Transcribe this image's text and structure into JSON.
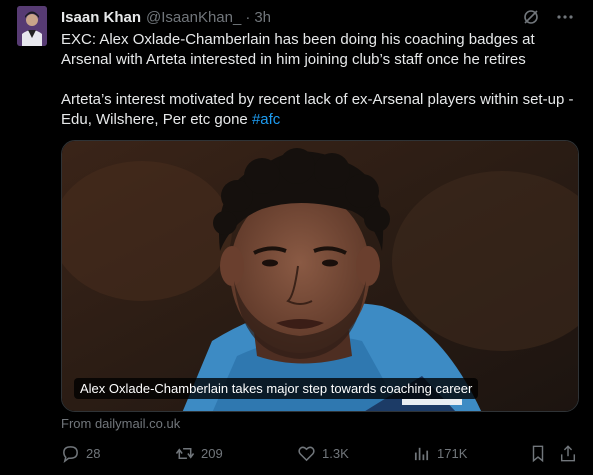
{
  "tweet": {
    "author_name": "Isaan Khan",
    "handle": "@IsaanKhan_",
    "separator": "·",
    "time": "3h",
    "paragraph_1": "EXC: Alex Oxlade-Chamberlain has been doing his coaching badges at Arsenal with Arteta interested in him joining club’s staff once he retires",
    "paragraph_2": "Arteta’s interest motivated by recent lack of ex-Arsenal players within set-up - Edu, Wilshere, Per etc gone ",
    "hashtag": "#afc"
  },
  "media": {
    "caption": "Alex Oxlade-Chamberlain takes major step towards coaching career",
    "source": "From dailymail.co.uk"
  },
  "actions": {
    "replies": "28",
    "reposts": "209",
    "likes": "1.3K",
    "views": "171K"
  },
  "icons": {
    "header": [
      "grok-icon",
      "more-icon"
    ],
    "actions": [
      "reply-icon",
      "repost-icon",
      "like-icon",
      "views-icon",
      "bookmark-icon",
      "share-icon"
    ]
  },
  "colors": {
    "background": "#000000",
    "text": "#e7e9ea",
    "muted": "#71767b",
    "link": "#1d9bf0"
  }
}
